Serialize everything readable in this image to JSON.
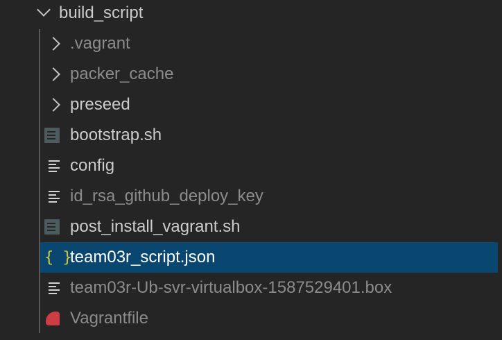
{
  "explorer": {
    "folder": {
      "name": "build_script",
      "expanded": true
    },
    "items": [
      {
        "label": ".vagrant",
        "type": "folder",
        "icon": "chevron-right-icon",
        "ignored": true
      },
      {
        "label": "packer_cache",
        "type": "folder",
        "icon": "chevron-right-icon",
        "ignored": true
      },
      {
        "label": "preseed",
        "type": "folder",
        "icon": "chevron-right-icon",
        "ignored": false
      },
      {
        "label": "bootstrap.sh",
        "type": "file",
        "icon": "shell-file-icon",
        "ignored": false
      },
      {
        "label": "config",
        "type": "file",
        "icon": "text-file-icon",
        "ignored": false
      },
      {
        "label": "id_rsa_github_deploy_key",
        "type": "file",
        "icon": "text-file-icon",
        "ignored": true
      },
      {
        "label": "post_install_vagrant.sh",
        "type": "file",
        "icon": "shell-file-icon",
        "ignored": false
      },
      {
        "label": "team03r_script.json",
        "type": "file",
        "icon": "json-file-icon",
        "ignored": false,
        "selected": true
      },
      {
        "label": "team03r-Ub-svr-virtualbox-1587529401.box",
        "type": "file",
        "icon": "text-file-icon",
        "ignored": true
      },
      {
        "label": "Vagrantfile",
        "type": "file",
        "icon": "vagrant-file-icon",
        "ignored": true
      }
    ],
    "json_icon_glyph": "{ }"
  },
  "colors": {
    "background": "#252526",
    "selection": "#094771",
    "json_icon": "#cbcb41",
    "vagrant_icon": "#cc3e44",
    "shell_icon": "#4d5a5e"
  }
}
